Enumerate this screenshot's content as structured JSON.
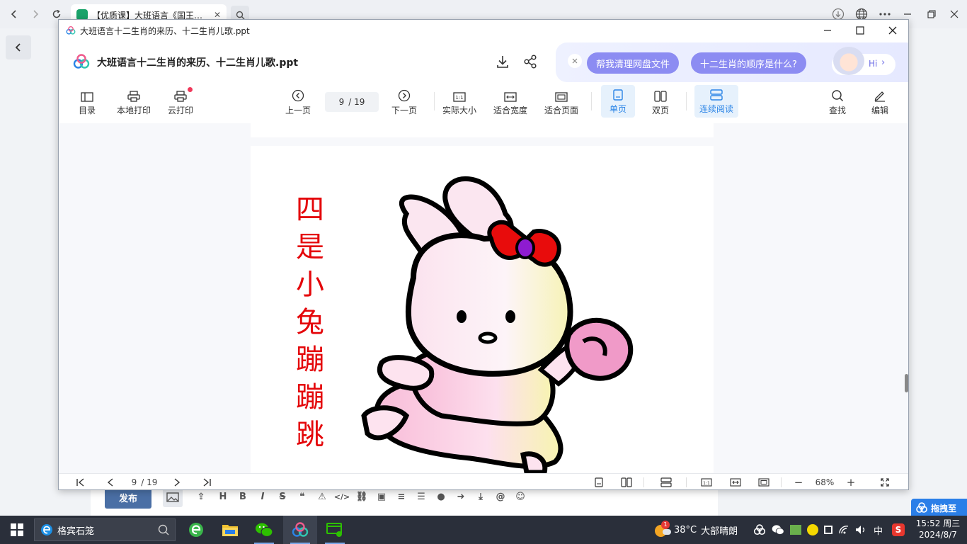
{
  "browser": {
    "tab_title": "【优质课】大班语言《国王生日》",
    "tab_close": "✕"
  },
  "viewer": {
    "window_title": "大班语言十二生肖的来历、十二生肖儿歌.ppt",
    "doc_title": "大班语言十二生肖的来历、十二生肖儿歌.ppt",
    "ai": {
      "chip1": "帮我清理网盘文件",
      "chip2": "十二生肖的顺序是什么?",
      "hi": "Hi"
    },
    "toolbar": {
      "toc": "目录",
      "local_print": "本地打印",
      "cloud_print": "云打印",
      "prev": "上一页",
      "page_current": "9",
      "page_total": "/ 19",
      "next": "下一页",
      "actual_size": "实际大小",
      "fit_width": "适合宽度",
      "fit_page": "适合页面",
      "single": "单页",
      "double": "双页",
      "continuous": "连续阅读",
      "find": "查找",
      "edit": "编辑"
    },
    "slide": {
      "chars": [
        "四",
        "是",
        "小",
        "兔",
        "蹦",
        "蹦",
        "跳"
      ]
    },
    "status": {
      "page_current": "9",
      "page_total": "/ 19",
      "zoom": "68%",
      "minus": "−",
      "plus": "+"
    }
  },
  "editor": {
    "publish": "发布",
    "drag_label": "拖拽至"
  },
  "taskbar": {
    "search_text": "格宾石笼",
    "weather_temp": "38°C",
    "weather_desc": "大部晴朗",
    "weather_badge": "1",
    "ime": "中",
    "time": "15:52 周三",
    "date": "2024/8/7"
  },
  "colors": {
    "accent": "#2a84e6",
    "chip": "#8c8cf2",
    "slide_text": "#e4060a",
    "taskbar": "#2a2f3a"
  }
}
